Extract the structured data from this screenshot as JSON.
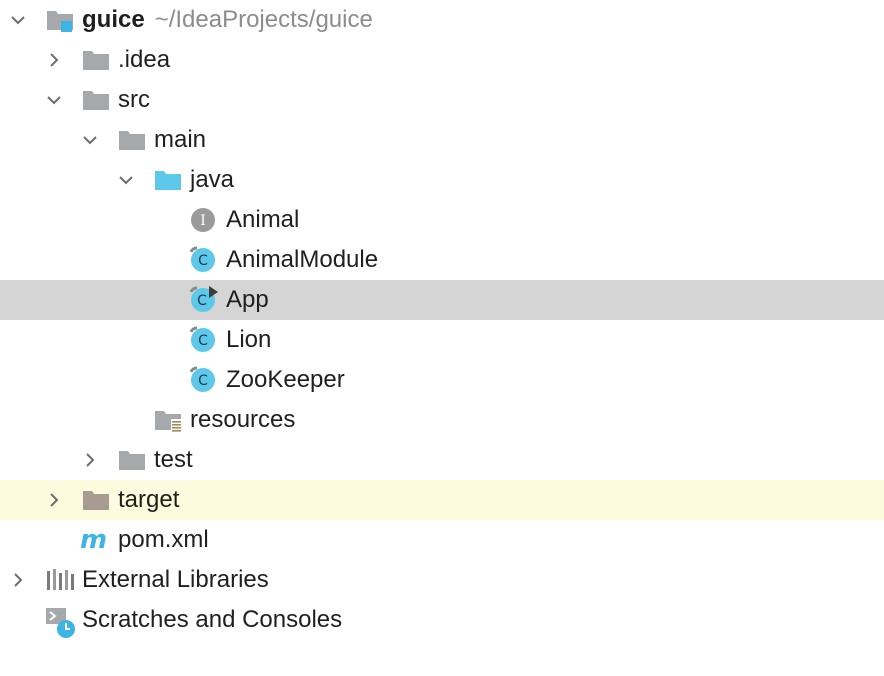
{
  "tree": {
    "root": {
      "name": "guice",
      "path": "~/IdeaProjects/guice",
      "icon": "module-folder-icon"
    },
    "idea": {
      "label": ".idea",
      "icon": "folder-icon"
    },
    "src": {
      "label": "src",
      "icon": "folder-icon"
    },
    "main": {
      "label": "main",
      "icon": "folder-icon"
    },
    "java": {
      "label": "java",
      "icon": "source-root-folder-icon"
    },
    "animal": {
      "label": "Animal",
      "icon": "interface-icon",
      "badge": "I"
    },
    "animal_module": {
      "label": "AnimalModule",
      "icon": "class-icon",
      "badge": "C"
    },
    "app": {
      "label": "App",
      "icon": "runnable-class-icon",
      "badge": "C"
    },
    "lion": {
      "label": "Lion",
      "icon": "class-icon",
      "badge": "C"
    },
    "zookeeper": {
      "label": "ZooKeeper",
      "icon": "class-icon",
      "badge": "C"
    },
    "resources": {
      "label": "resources",
      "icon": "resources-folder-icon"
    },
    "test": {
      "label": "test",
      "icon": "folder-icon"
    },
    "target": {
      "label": "target",
      "icon": "excluded-folder-icon"
    },
    "pom": {
      "label": "pom.xml",
      "icon": "maven-icon",
      "badge": "m"
    },
    "external_libraries": {
      "label": "External Libraries",
      "icon": "libraries-icon"
    },
    "scratches": {
      "label": "Scratches and Consoles",
      "icon": "scratches-icon"
    }
  },
  "colors": {
    "selected_row": "#d5d5d5",
    "excluded_row": "#fdfbde",
    "folder_gray": "#a5a9ac",
    "source_blue": "#5ec8ea",
    "class_blue": "#5ec8ea",
    "interface_gray": "#9a9a9a",
    "excluded_brown": "#a89b92",
    "path_gray": "#8c8c8c"
  }
}
